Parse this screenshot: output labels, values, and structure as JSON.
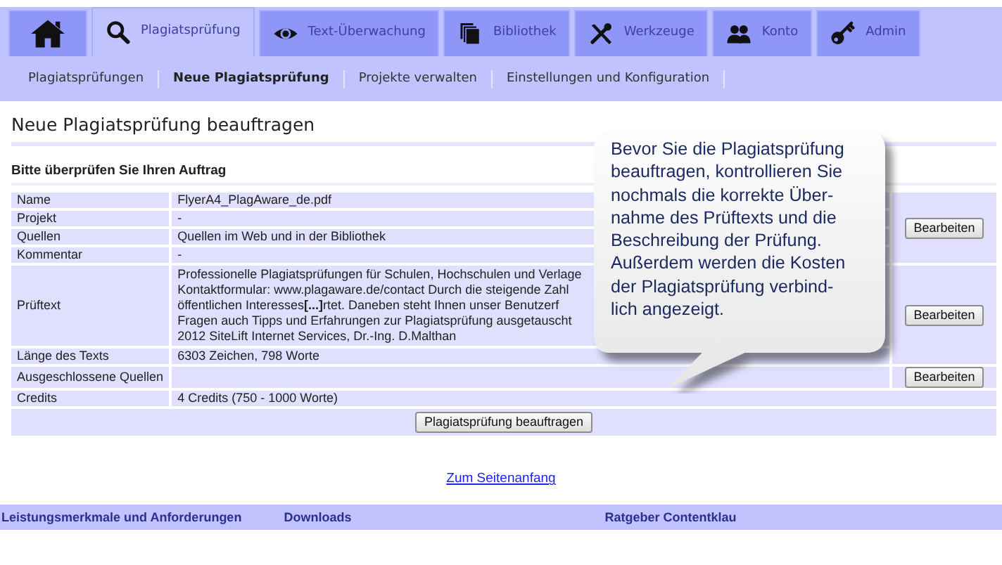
{
  "tabs": [
    {
      "selected": false
    },
    {
      "label": "Plagiatsprüfung",
      "selected": true
    },
    {
      "label": "Text-Überwachung",
      "selected": false
    },
    {
      "label": "Bibliothek",
      "selected": false
    },
    {
      "label": "Werkzeuge",
      "selected": false
    },
    {
      "label": "Konto",
      "selected": false
    },
    {
      "label": "Admin",
      "selected": false
    }
  ],
  "subnav": [
    {
      "label": "Plagiatsprüfungen",
      "selected": false
    },
    {
      "label": "Neue Plagiatsprüfung",
      "selected": true
    },
    {
      "label": "Projekte verwalten",
      "selected": false
    },
    {
      "label": "Einstellungen und Konfiguration",
      "selected": false
    }
  ],
  "page_title": "Neue Plagiatsprüfung beauftragen",
  "section_title": "Bitte überprüfen Sie Ihren Auftrag",
  "order_table": {
    "groups": [
      {
        "button": "Bearbeiten",
        "rows": [
          {
            "label": "Name",
            "value": [
              "FlyerA4_PlagAware_de.pdf"
            ]
          },
          {
            "label": "Projekt",
            "value": [
              "-"
            ]
          },
          {
            "label": "Quellen",
            "value": [
              "Quellen im Web und in der Bibliothek"
            ]
          },
          {
            "label": "Kommentar",
            "value": [
              "-"
            ]
          }
        ]
      },
      {
        "button": "Bearbeiten",
        "rows": [
          {
            "label": "Prüftext",
            "value": [
              "Professionelle Plagiatsprüfungen für Schulen, Hochschulen und Verlage",
              "Kontaktformular: www.plagaware.de/contact Durch die steigende Zahl",
              "öffentlichen Interesses**[...]**rtet. Daneben steht Ihnen unser Benutzerf",
              "Fragen auch Tipps und Erfahrungen zur Plagiatsprüfung ausgetauscht",
              "2012 SiteLift Internet Services, Dr.-Ing. D.Malthan"
            ]
          },
          {
            "label": "Länge des Texts",
            "value": [
              "6303 Zeichen, 798 Worte"
            ]
          }
        ]
      },
      {
        "button": "Bearbeiten",
        "rows": [
          {
            "label": "Ausgeschlossene Quellen",
            "value": []
          }
        ]
      },
      {
        "rows": [
          {
            "label": "Credits",
            "value": [
              "4 Credits (750 - 1000 Worte)"
            ]
          }
        ]
      }
    ],
    "submit_button": "Plagiatsprüfung beauftragen"
  },
  "tooltip_lines": [
    "Bevor Sie die Plagiatsprüfung",
    "beauftragen, kontrollieren Sie",
    "nochmals die korrekte Über-",
    "nahme des Prüftexts und die",
    "Beschreibung der Prüfung.",
    "Außerdem werden die Kosten",
    "der Plagiatsprüfung verbind-",
    "lich angezeigt."
  ],
  "top_link": "Zum Seitenanfang",
  "footer_links": [
    "Leistungsmerkmale und Anforderungen",
    "Downloads",
    "Ratgeber Contentklau"
  ]
}
